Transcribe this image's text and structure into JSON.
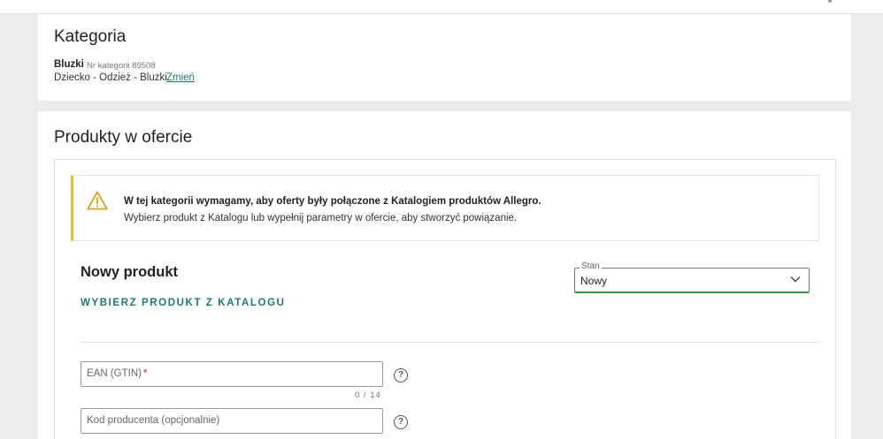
{
  "category_section": {
    "title": "Kategoria",
    "category_name": "Bluzki",
    "category_number": "Nr kategorii 89508",
    "path": "Dziecko - Odzież - Bluzki",
    "change_link": "Zmień"
  },
  "products_section": {
    "title": "Produkty w ofercie",
    "alert": {
      "icon": "warning-icon",
      "bold_text": "W tej kategorii wymagamy, aby oferty były połączone z Katalogiem produktów Allegro.",
      "text": "Wybierz produkt z Katalogu lub wypełnij parametry w ofercie, aby stworzyć powiązanie."
    },
    "new_product": {
      "title": "Nowy produkt",
      "catalog_link": "WYBIERZ PRODUKT Z KATALOGU",
      "stan": {
        "label": "Stan",
        "value": "Nowy"
      },
      "ean": {
        "placeholder": "EAN (GTIN)",
        "required_mark": "*",
        "counter": "0 / 14"
      },
      "kod": {
        "placeholder": "Kod producenta (opcjonalnie)"
      },
      "help_glyph": "?"
    }
  },
  "colors": {
    "accent": "#1a7b74",
    "warning": "#e5c02a",
    "success_underline": "#2f9e35",
    "required": "#d4212a"
  }
}
